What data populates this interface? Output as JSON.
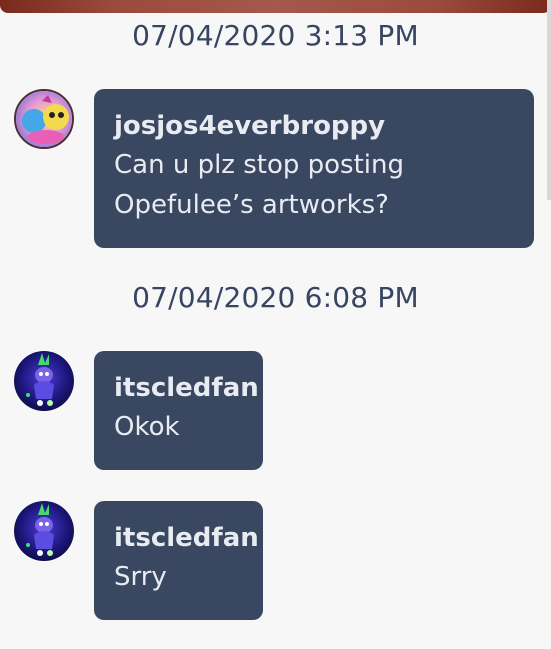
{
  "chat": {
    "timestamps": [
      "07/04/2020 3:13 PM",
      "07/04/2020 6:08 PM"
    ],
    "messages": [
      {
        "username": "josjos4everbroppy",
        "text": "Can u plz stop posting Opefulee’s artworks?"
      },
      {
        "username": "itscledfan",
        "text": "Okok"
      },
      {
        "username": "itscledfan",
        "text": "Srry"
      }
    ]
  },
  "colors": {
    "background": "#f7f7f7",
    "bubble": "#3a4760",
    "timestamp_text": "#374561",
    "bubble_text": "#e8ecf2"
  },
  "icons": {
    "avatar1": "avatar-colorful-character",
    "avatar2": "avatar-troll-character",
    "avatar3": "avatar-troll-character"
  }
}
